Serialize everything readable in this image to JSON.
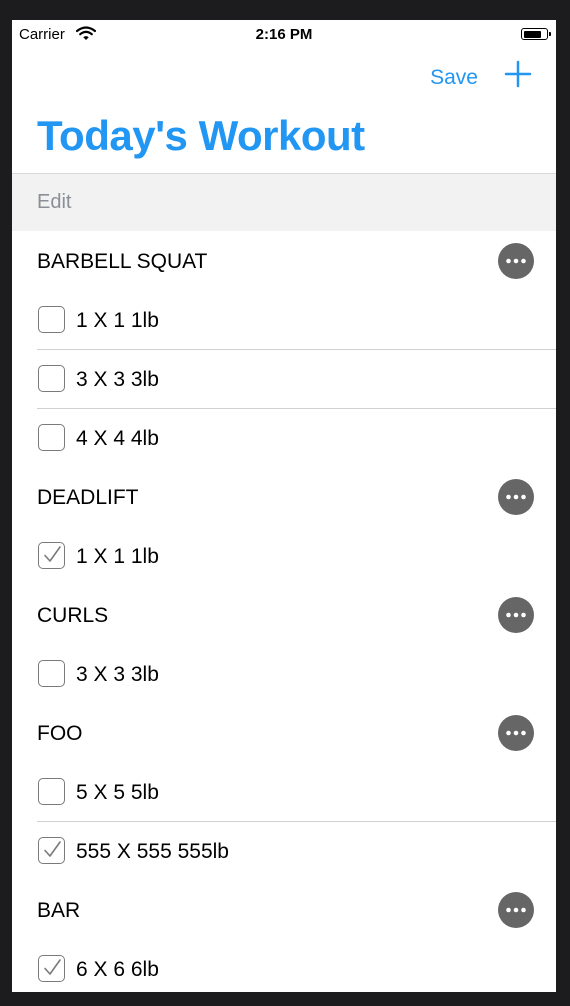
{
  "status_bar": {
    "carrier": "Carrier",
    "time": "2:16 PM"
  },
  "nav": {
    "save_label": "Save",
    "title": "Today's Workout",
    "edit_label": "Edit"
  },
  "accent_color": "#2196f3",
  "exercises": [
    {
      "name": "BARBELL SQUAT",
      "sets": [
        {
          "label": "1 X 1 1lb",
          "checked": false
        },
        {
          "label": "3 X 3 3lb",
          "checked": false
        },
        {
          "label": "4 X 4 4lb",
          "checked": false
        }
      ]
    },
    {
      "name": "DEADLIFT",
      "sets": [
        {
          "label": "1 X 1 1lb",
          "checked": true
        }
      ]
    },
    {
      "name": "CURLS",
      "sets": [
        {
          "label": "3 X 3 3lb",
          "checked": false
        }
      ]
    },
    {
      "name": "FOO",
      "sets": [
        {
          "label": "5 X 5 5lb",
          "checked": false
        },
        {
          "label": "555 X 555 555lb",
          "checked": true
        }
      ]
    },
    {
      "name": "BAR",
      "sets": [
        {
          "label": "6 X 6 6lb",
          "checked": true
        }
      ]
    }
  ]
}
